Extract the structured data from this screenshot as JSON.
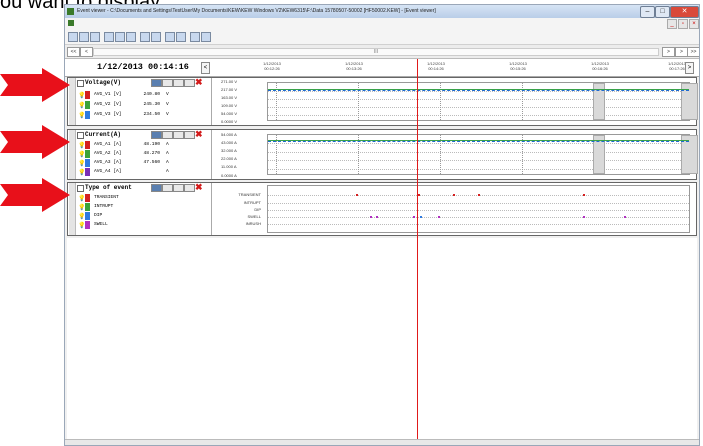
{
  "caption": "ou want to display:",
  "window": {
    "title": "Event viewer - C:\\Documents and Settings\\TestUser\\My Documents\\KEW\\KEW Windows V2\\KEW6315\\F:\\Data 15780507-50002 [HF50002.KEW] - [Event viewer]",
    "buttons": {
      "minimize": "–",
      "maximize": "□",
      "close": "✕"
    },
    "mdi_buttons": {
      "minimize": "_",
      "restore": "▫",
      "close": "×"
    }
  },
  "toolbar_icons": [
    "open-icon",
    "save-icon",
    "print-icon",
    "chart-icon",
    "zoom-in-icon",
    "zoom-out-icon",
    "window-icon",
    "export-icon",
    "settings-icon",
    "color-icon",
    "grid-icon",
    "table-icon"
  ],
  "nav": {
    "first": "<<",
    "prev": "<",
    "next": ">",
    "scroll_grip": "III",
    "next_right": ">",
    "last": ">>"
  },
  "time_header": {
    "current_time": "1/12/2013  00:14:16",
    "left_button": "<",
    "right_button": ">",
    "ticks": [
      {
        "date": "1/12/2013",
        "time": "00:12:26"
      },
      {
        "date": "1/12/2013",
        "time": "00:13:26"
      },
      {
        "date": "1/12/2013",
        "time": "00:14:26"
      },
      {
        "date": "1/12/2013",
        "time": "00:15:26"
      },
      {
        "date": "1/12/2013",
        "time": "00:16:26"
      },
      {
        "date": "1/12/2013",
        "time": "00:17:26"
      }
    ]
  },
  "voltage": {
    "title": "Voltage(V)",
    "channels": [
      {
        "name": "AVG_V1 [V]",
        "value": "240.80",
        "unit": "V",
        "color": "#d42020"
      },
      {
        "name": "AVG_V2 [V]",
        "value": "245.30",
        "unit": "V",
        "color": "#3aa33a"
      },
      {
        "name": "AVG_V3 [V]",
        "value": "234.50",
        "unit": "V",
        "color": "#2f7be0"
      }
    ],
    "yticks": [
      "271.00 V",
      "217.00 V",
      "163.00 V",
      "109.00 V",
      "54.000 V",
      "0.0000 V"
    ]
  },
  "current": {
    "title": "Current(A)",
    "channels": [
      {
        "name": "AVG_A1 [A]",
        "value": "48.190",
        "unit": "A",
        "color": "#d42020"
      },
      {
        "name": "AVG_A2 [A]",
        "value": "48.270",
        "unit": "A",
        "color": "#3aa33a"
      },
      {
        "name": "AVG_A3 [A]",
        "value": "47.560",
        "unit": "A",
        "color": "#2f7be0"
      },
      {
        "name": "AVG_A4 [A]",
        "value": "",
        "unit": "A",
        "color": "#7a2fb5"
      }
    ],
    "yticks": [
      "54.000 A",
      "43.000 A",
      "32.000 A",
      "22.000 A",
      "11.000 A",
      "0.0000 A"
    ]
  },
  "events": {
    "title": "Type of event",
    "channels": [
      {
        "name": "TRANSIENT",
        "color": "#d42020"
      },
      {
        "name": "INTRUPT",
        "color": "#3aa33a"
      },
      {
        "name": "DIP",
        "color": "#2f7be0"
      },
      {
        "name": "SWELL",
        "color": "#b02fc0"
      }
    ],
    "rows": [
      "TRANSIENT",
      "INTRUPT",
      "DIP",
      "SWELL",
      "INRUSH"
    ]
  },
  "bottom_scroll": "III"
}
